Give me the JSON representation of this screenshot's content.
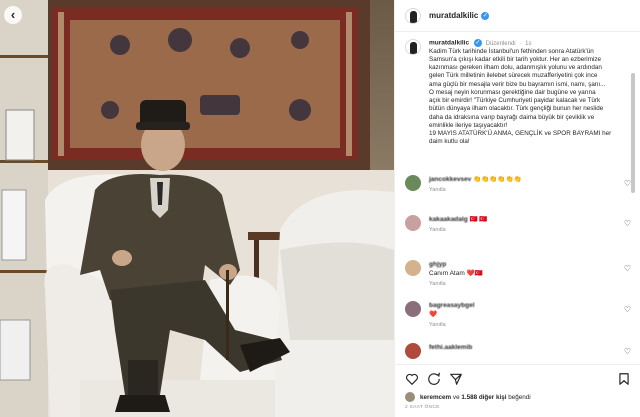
{
  "photo": {
    "alt_icon": "back-icon"
  },
  "post": {
    "username": "muratdalkilic",
    "edited_label": "Düzenlendi",
    "time_ago": "1s",
    "caption_lines": [
      "Kadim Türk tarihinde İstanbul'un fethinden sonra Atatürk'ün",
      "Samsun'a çıkışı kadar etkili bir tarih yoktur. Her an ezberimize",
      "kazınması gereken ilham dolu, adanmışlık yolunu ve ardından",
      "gelen Türk milletinin ilelebet sürecek muzafferiyetini çok ince",
      "ama güçlü bir mesajla verir bize bu bayramın ismi, namı, şanı...",
      "O mesaj neyin korunması gerektiğine dair bugüne ve yarına",
      "açık bir emirdir! \"Türkiye Cumhuriyeti payidar kalacak ve Türk",
      "bütün dünyaya ilham olacaktır. Türk gençliği bunun her neslide",
      "daha da idraksına varıp bayrağı daima büyük bir çeviklik ve",
      "eminlikle ileriye taşıyacaktır!",
      "19 MAYIS ATATÜRK'Ü ANMA, GENÇLİK ve SPOR BAYRAMI her",
      "daim kutlu ola!"
    ]
  },
  "comments": [
    {
      "user": "jancokkevsev",
      "text": "👏👏👏👏👏👏",
      "reply": "Yanıtla",
      "avatar_color": "#6b8a5a"
    },
    {
      "user": "kakaakadalg",
      "text": "🇹🇷 🇹🇷",
      "reply": "Yanıtla",
      "avatar_color": "#c9a0a0"
    },
    {
      "user": "ghjyp",
      "text": "Canım Atam ❤️🇹🇷",
      "reply": "Yanıtla",
      "avatar_color": "#d4b28c"
    },
    {
      "user": "bagreasaybgel",
      "text": "❤️",
      "reply": "Yanıtla",
      "avatar_color": "#8c6e7a"
    },
    {
      "user": "fethi.aaklemib",
      "text": "",
      "reply": "",
      "avatar_color": "#b04a3a"
    }
  ],
  "footer": {
    "liked_by_user": "keremcem",
    "liked_by_connector": "ve",
    "liked_by_others": "1.588 diğer kişi",
    "liked_by_suffix": "beğendi",
    "date": "2 SAAT ÖNCE"
  },
  "colors": {
    "verified": "#3897f0",
    "border": "#efefef",
    "muted": "#8e8e8e"
  }
}
